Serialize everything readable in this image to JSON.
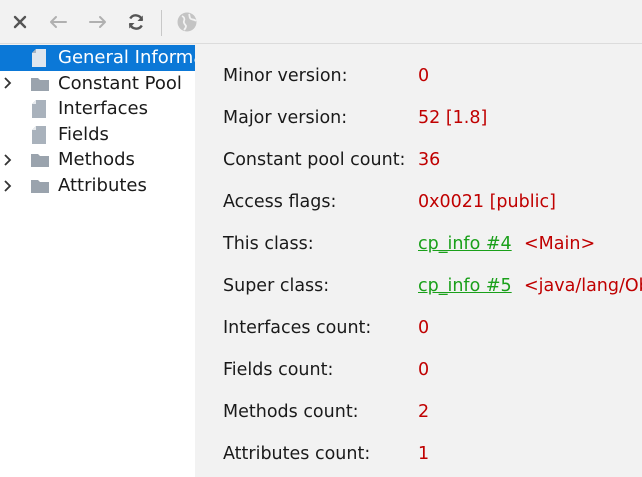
{
  "toolbar": {
    "icons": [
      "close-icon",
      "back-arrow-icon",
      "forward-arrow-icon",
      "refresh-icon",
      "globe-icon"
    ]
  },
  "tree": {
    "items": [
      {
        "label": "General Information",
        "selected": true,
        "expandable": false,
        "icon": "file-icon"
      },
      {
        "label": "Constant Pool",
        "selected": false,
        "expandable": true,
        "icon": "folder-icon"
      },
      {
        "label": "Interfaces",
        "selected": false,
        "expandable": false,
        "icon": "file-icon"
      },
      {
        "label": "Fields",
        "selected": false,
        "expandable": false,
        "icon": "file-icon"
      },
      {
        "label": "Methods",
        "selected": false,
        "expandable": true,
        "icon": "folder-icon"
      },
      {
        "label": "Attributes",
        "selected": false,
        "expandable": true,
        "icon": "folder-icon"
      }
    ]
  },
  "details": {
    "minor_version": {
      "label": "Minor version:",
      "value": "0"
    },
    "major_version": {
      "label": "Major version:",
      "value": "52 [1.8]"
    },
    "constant_pool_count": {
      "label": "Constant pool count:",
      "value": "36"
    },
    "access_flags": {
      "label": "Access flags:",
      "value": "0x0021 [public]"
    },
    "this_class": {
      "label": "This class:",
      "link": "cp_info #4",
      "ref": "<Main>"
    },
    "super_class": {
      "label": "Super class:",
      "link": "cp_info #5",
      "ref": "<java/lang/Object>"
    },
    "interfaces_count": {
      "label": "Interfaces count:",
      "value": "0"
    },
    "fields_count": {
      "label": "Fields count:",
      "value": "0"
    },
    "methods_count": {
      "label": "Methods count:",
      "value": "2"
    },
    "attributes_count": {
      "label": "Attributes count:",
      "value": "1"
    }
  },
  "colors": {
    "selection": "#0b78d7",
    "value_red": "#c00000",
    "link_green": "#1aa01a",
    "panel_bg": "#f2f2f2"
  }
}
